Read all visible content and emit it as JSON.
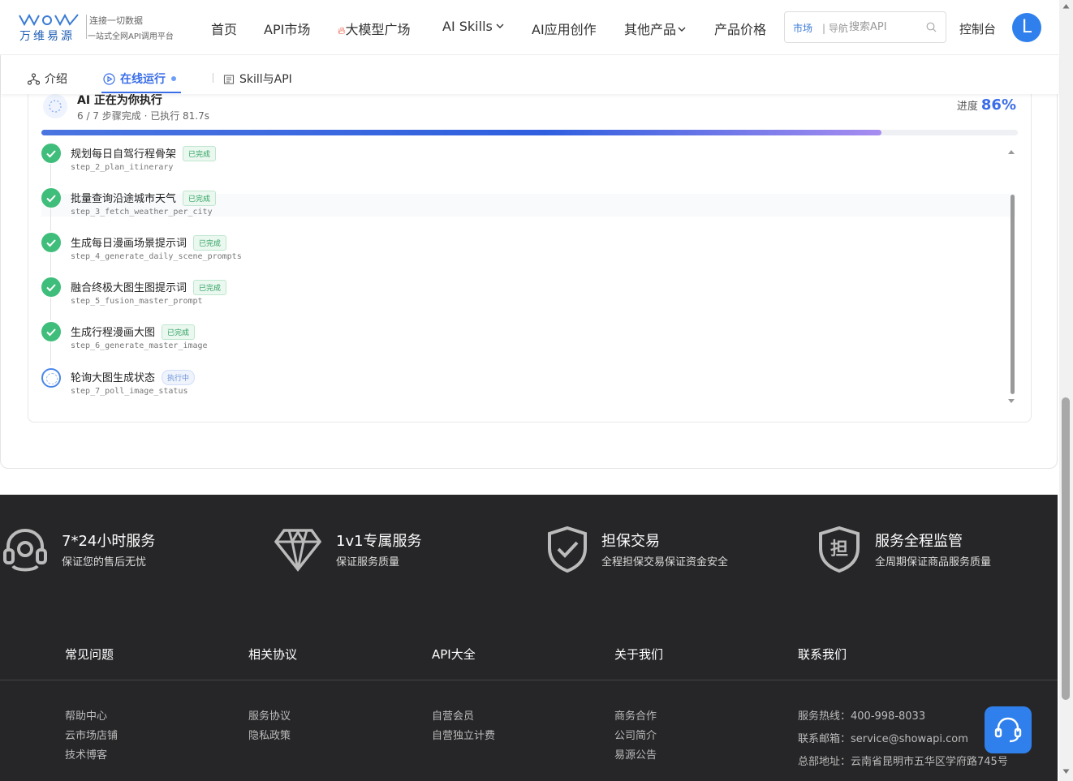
{
  "brand": {
    "logo_name": "万维易源",
    "slogan_line1": "连接一切数据",
    "slogan_line2": "一站式全网API调用平台"
  },
  "nav": {
    "home": "首页",
    "api_market": "API市场",
    "llm_plaza": "大模型广场",
    "ai_skills": "AI Skills",
    "ai_create": "AI应用创作",
    "other_products": "其他产品",
    "pricing": "产品价格"
  },
  "search": {
    "tag_market": "市场",
    "tag_nav": "| 导航",
    "placeholder": "搜索API"
  },
  "user": {
    "console_label": "控制台",
    "avatar_letter": "L"
  },
  "tabs": {
    "intro": "介绍",
    "run_online": "在线运行",
    "skill_api": "Skill与API"
  },
  "execution": {
    "title": "AI 正在为你执行",
    "subtitle": "6 / 7 步骤完成 · 已执行 81.7s",
    "progress_label": "进度",
    "progress_value": "86%",
    "progress_fraction": 0.86,
    "steps": [
      {
        "name": "规划每日自驾行程骨架",
        "id": "step_2_plan_itinerary",
        "status": "已完成",
        "state": "done"
      },
      {
        "name": "批量查询沿途城市天气",
        "id": "step_3_fetch_weather_per_city",
        "status": "已完成",
        "state": "done"
      },
      {
        "name": "生成每日漫画场景提示词",
        "id": "step_4_generate_daily_scene_prompts",
        "status": "已完成",
        "state": "done"
      },
      {
        "name": "融合终极大图生图提示词",
        "id": "step_5_fusion_master_prompt",
        "status": "已完成",
        "state": "done"
      },
      {
        "name": "生成行程漫画大图",
        "id": "step_6_generate_master_image",
        "status": "已完成",
        "state": "done"
      },
      {
        "name": "轮询大图生成状态",
        "id": "step_7_poll_image_status",
        "status": "执行中",
        "state": "running"
      }
    ]
  },
  "footer": {
    "features": [
      {
        "title": "7*24小时服务",
        "desc": "保证您的售后无忧",
        "icon": "headset-icon"
      },
      {
        "title": "1v1专属服务",
        "desc": "保证服务质量",
        "icon": "diamond-icon"
      },
      {
        "title": "担保交易",
        "desc": "全程担保交易保证资金安全",
        "icon": "shield-check-icon"
      },
      {
        "title": "服务全程监管",
        "desc": "全周期保证商品服务质量",
        "icon": "shield-dan-icon",
        "glyph": "担"
      }
    ],
    "columns": {
      "faq": {
        "title": "常见问题",
        "links": [
          "帮助中心",
          "云市场店铺",
          "技术博客"
        ]
      },
      "agreements": {
        "title": "相关协议",
        "links": [
          "服务协议",
          "隐私政策"
        ]
      },
      "apis": {
        "title": "API大全",
        "links": [
          "自营会员",
          "自营独立计费"
        ]
      },
      "about": {
        "title": "关于我们",
        "links": [
          "商务合作",
          "公司简介",
          "易源公告"
        ]
      },
      "contact": {
        "title": "联系我们",
        "hotline": "服务热线：400-998-8033",
        "email": "联系邮箱：service@showapi.com",
        "address": "总部地址：云南省昆明市五华区学府路745号"
      }
    }
  },
  "colors": {
    "accent": "#3a6ee8",
    "success": "#3fbd7a",
    "footer_bg": "#262628"
  }
}
